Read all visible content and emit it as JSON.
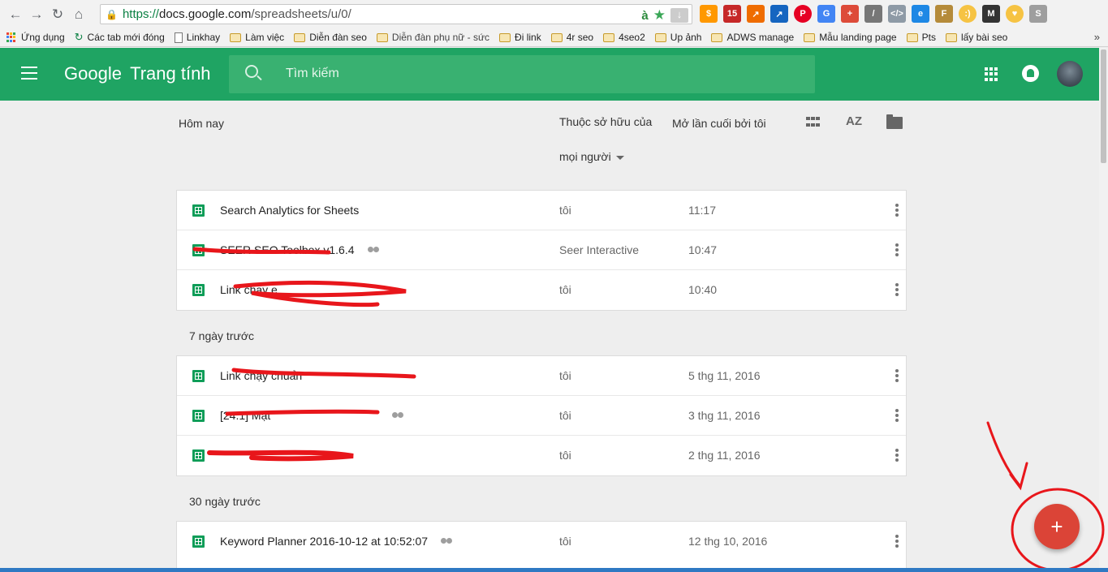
{
  "browser": {
    "url_secure": "https://",
    "url_host": "docs.google.com",
    "url_path": "/spreadsheets/u/0/",
    "bookmarks": [
      {
        "label": "Ứng dụng",
        "icon": "apps-icon"
      },
      {
        "label": "Các tab mới đóng",
        "icon": "history-icon"
      },
      {
        "label": "Linkhay",
        "icon": "page-icon"
      },
      {
        "label": "Làm việc",
        "icon": "folder-icon"
      },
      {
        "label": "Diễn đàn seo",
        "icon": "folder-icon"
      },
      {
        "label": "Diễn đàn phụ nữ - sức",
        "icon": "folder-icon"
      },
      {
        "label": "Đi link",
        "icon": "folder-icon"
      },
      {
        "label": "4r seo",
        "icon": "folder-icon"
      },
      {
        "label": "4seo2",
        "icon": "folder-icon"
      },
      {
        "label": "Up ảnh",
        "icon": "folder-icon"
      },
      {
        "label": "ADWS manage",
        "icon": "folder-icon"
      },
      {
        "label": "Mẫu landing page",
        "icon": "folder-icon"
      },
      {
        "label": "Pts",
        "icon": "folder-icon"
      },
      {
        "label": "lấy bài seo",
        "icon": "folder-icon"
      }
    ],
    "more": "»"
  },
  "header": {
    "brand_google": "Google",
    "brand_app": "Trang tính",
    "search_placeholder": "Tìm kiếm",
    "accent_color": "#1fa463"
  },
  "list_header": {
    "today": "Hôm nay",
    "owner_line1": "Thuộc sở hữu của",
    "owner_line2": "mọi người",
    "last_opened": "Mở lần cuối bởi tôi",
    "sort_label": "AZ"
  },
  "sections": [
    {
      "label": "Hôm nay",
      "rows": [
        {
          "title": "Search Analytics for Sheets",
          "shared": false,
          "owner": "tôi",
          "date": "11:17"
        },
        {
          "title": "SEER SEO Toolbox v1.6.4",
          "shared": true,
          "owner": "Seer Interactive",
          "date": "10:47"
        },
        {
          "title": "Link chạy e",
          "shared": false,
          "owner": "tôi",
          "date": "10:40"
        }
      ]
    },
    {
      "label": "7 ngày trước",
      "rows": [
        {
          "title": "Link chạy chuẩn",
          "shared": false,
          "owner": "tôi",
          "date": "5 thg 11, 2016"
        },
        {
          "title": "[24.1] Mật",
          "shared": true,
          "owner": "tôi",
          "date": "3 thg 11, 2016"
        },
        {
          "title": "",
          "shared": false,
          "owner": "tôi",
          "date": "2 thg 11, 2016"
        }
      ]
    },
    {
      "label": "30 ngày trước",
      "rows": [
        {
          "title": "Keyword Planner 2016-10-12 at 10:52:07",
          "shared": true,
          "owner": "tôi",
          "date": "12 thg 10, 2016"
        }
      ]
    }
  ],
  "fab": {
    "label": "+",
    "color": "#db4437"
  }
}
